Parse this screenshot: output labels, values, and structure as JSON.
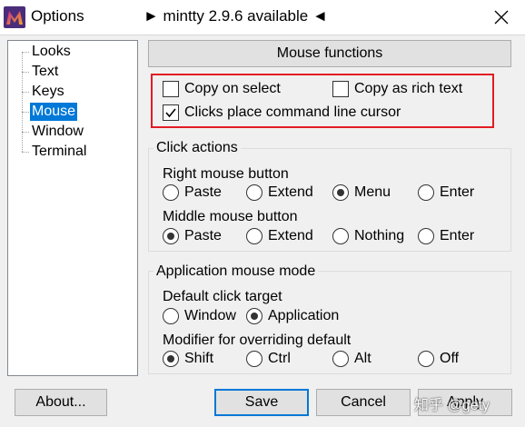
{
  "window": {
    "title": "Options",
    "update_notice": "► mintty 2.9.6 available ◄",
    "close_glyph": "✕"
  },
  "tree": {
    "items": [
      {
        "label": "Looks",
        "selected": false
      },
      {
        "label": "Text",
        "selected": false
      },
      {
        "label": "Keys",
        "selected": false
      },
      {
        "label": "Mouse",
        "selected": true
      },
      {
        "label": "Window",
        "selected": false
      },
      {
        "label": "Terminal",
        "selected": false
      }
    ]
  },
  "section": {
    "title": "Mouse functions"
  },
  "options": {
    "copy_on_select": {
      "label": "Copy on select",
      "checked": false
    },
    "copy_as_rich_text": {
      "label": "Copy as rich text",
      "checked": false
    },
    "clicks_place_cursor": {
      "label": "Clicks place command line cursor",
      "checked": true
    }
  },
  "click_actions": {
    "title": "Click actions",
    "right": {
      "label": "Right mouse button",
      "options": [
        "Paste",
        "Extend",
        "Menu",
        "Enter"
      ],
      "selected": "Menu"
    },
    "middle": {
      "label": "Middle mouse button",
      "options": [
        "Paste",
        "Extend",
        "Nothing",
        "Enter"
      ],
      "selected": "Paste"
    }
  },
  "app_mouse_mode": {
    "title": "Application mouse mode",
    "target": {
      "label": "Default click target",
      "options": [
        "Window",
        "Application"
      ],
      "selected": "Window"
    },
    "modifier": {
      "label": "Modifier for overriding default",
      "options": [
        "Shift",
        "Ctrl",
        "Alt",
        "Off"
      ],
      "selected": "Shift"
    }
  },
  "buttons": {
    "about": "About...",
    "save": "Save",
    "cancel": "Cancel",
    "apply": "Apply"
  },
  "watermark": "知乎 @gety",
  "colors": {
    "selection": "#0078d7",
    "highlight_border": "#e21b23",
    "dialog_bg": "#f0f0f0"
  }
}
